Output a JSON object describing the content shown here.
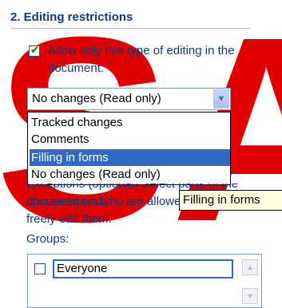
{
  "section": {
    "title": "2. Editing restrictions"
  },
  "allow_restriction": {
    "checked": true,
    "label": "Allow only this type of editing in the document:"
  },
  "editing_type": {
    "selected_value": "No changes (Read only)",
    "options": [
      "Tracked changes",
      "Comments",
      "Filling in forms",
      "No changes (Read only)"
    ],
    "highlighted_option": "Filling in forms"
  },
  "exceptions_text": {
    "partial_line": "Exceptions (optional) Select parts of the document and",
    "line1": "choose users who are allowed to",
    "line2": "freely edit them."
  },
  "tooltip": {
    "text": "Filling in forms"
  },
  "groups": {
    "label": "Groups:",
    "items": [
      {
        "label": "Everyone",
        "checked": false
      }
    ]
  },
  "watermark": {
    "text": "SA",
    "color": "#e00000"
  }
}
